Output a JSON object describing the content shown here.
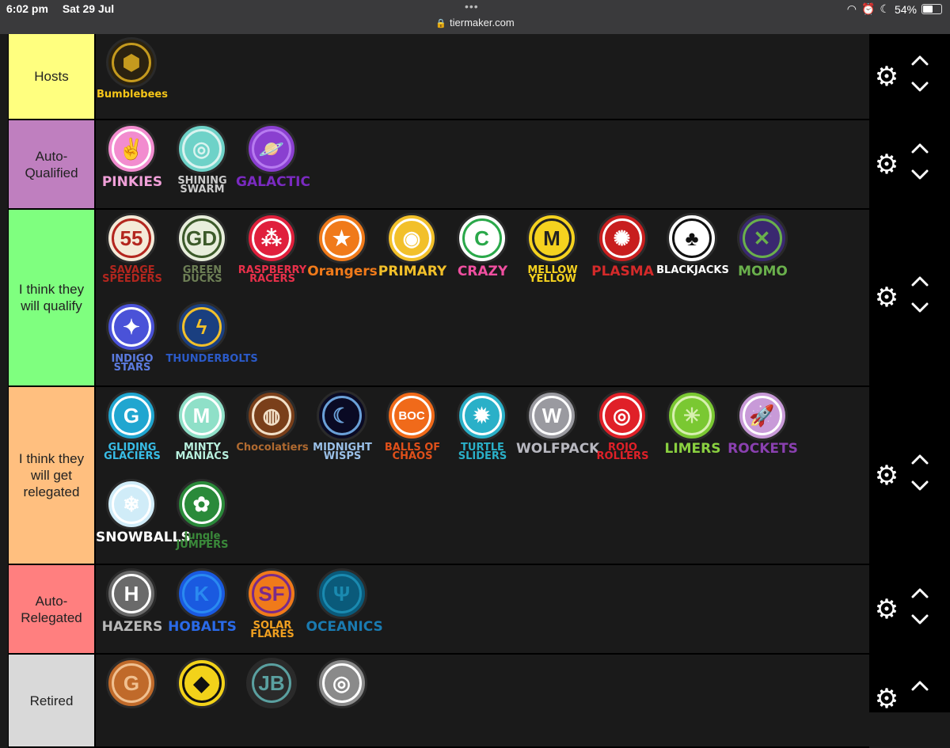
{
  "status": {
    "time": "6:02 pm",
    "date": "Sat 29 Jul",
    "battery": "54%",
    "dots": "•••"
  },
  "browser": {
    "url": "tiermaker.com"
  },
  "tiers": [
    {
      "label": "Hosts",
      "color": "#ffff7f",
      "teams": [
        {
          "name": "Bumblebees",
          "bg": "#2b2210",
          "ring": "#c59a1e",
          "fg": "#f5c518",
          "glyph": "⬢"
        }
      ]
    },
    {
      "label": "Auto-\nQualified",
      "color": "#bf7fbf",
      "teams": [
        {
          "name": "PINKIES",
          "bg": "#f28ccf",
          "ring": "#ffffff",
          "fg": "#f0a0d8",
          "glyph": "✌"
        },
        {
          "name": "SHINING SWARM",
          "bg": "#6ed2c8",
          "ring": "#d9f3ef",
          "fg": "#cccccc",
          "glyph": "◎"
        },
        {
          "name": "GALACTIC",
          "bg": "#8a3fd0",
          "ring": "#b77bf0",
          "fg": "#7a2ac0",
          "glyph": "🪐"
        }
      ]
    },
    {
      "label": "I think they\nwill qualify",
      "color": "#7fff7f",
      "teams": [
        {
          "name": "SAVAGE SPEEDERS",
          "bg": "#f4ead8",
          "ring": "#b3261e",
          "fg": "#b3261e",
          "glyph": "55"
        },
        {
          "name": "GREEN DUCKS",
          "bg": "#e8eedc",
          "ring": "#3c5a2a",
          "fg": "#6d7f55",
          "glyph": "GD"
        },
        {
          "name": "RASPBERRY RACERS",
          "bg": "#e0203c",
          "ring": "#ffffff",
          "fg": "#e8304a",
          "glyph": "⁂"
        },
        {
          "name": "Orangers",
          "bg": "#f07a1a",
          "ring": "#ffffff",
          "fg": "#f07a1a",
          "glyph": "★"
        },
        {
          "name": "PRIMARY",
          "bg": "#f2c02a",
          "ring": "#ffffff",
          "fg": "#f2c02a",
          "glyph": "◉"
        },
        {
          "name": "CRAZY",
          "bg": "#ffffff",
          "ring": "#2aa84a",
          "fg": "#f04fa0",
          "glyph": "C"
        },
        {
          "name": "MELLOW YELLOW",
          "bg": "#f5d21f",
          "ring": "#222222",
          "fg": "#f5d21f",
          "glyph": "M"
        },
        {
          "name": "PLASMA",
          "bg": "#c81e1e",
          "ring": "#ffffff",
          "fg": "#d42a2a",
          "glyph": "✺"
        },
        {
          "name": "BLACKJACKS",
          "bg": "#ffffff",
          "ring": "#111111",
          "fg": "#ffffff",
          "glyph": "♣"
        },
        {
          "name": "MOMO",
          "bg": "#3a2870",
          "ring": "#6ab04c",
          "fg": "#6ab04c",
          "glyph": "✕"
        },
        {
          "name": "INDIGO STARS",
          "bg": "#4a52d8",
          "ring": "#ffffff",
          "fg": "#5b7be0",
          "glyph": "✦"
        },
        {
          "name": "THUNDERBOLTS",
          "bg": "#1a3f80",
          "ring": "#f2c02a",
          "fg": "#2b5ac8",
          "glyph": "ϟ"
        }
      ]
    },
    {
      "label": "I think they\nwill get\nrelegated",
      "color": "#ffbf7f",
      "teams": [
        {
          "name": "GLIDING GLACIERS",
          "bg": "#20a6d0",
          "ring": "#ffffff",
          "fg": "#38bde6",
          "glyph": "G"
        },
        {
          "name": "MINTY MANIACS",
          "bg": "#8fe0c8",
          "ring": "#ffffff",
          "fg": "#b8f0de",
          "glyph": "M"
        },
        {
          "name": "Chocolatiers",
          "bg": "#7a3f1a",
          "ring": "#f2e0c8",
          "fg": "#b06a30",
          "glyph": "◍"
        },
        {
          "name": "MIDNIGHT WISPS",
          "bg": "#0a0a24",
          "ring": "#6aa0d8",
          "fg": "#9ac0e8",
          "glyph": "☾"
        },
        {
          "name": "BALLS OF CHAOS",
          "bg": "#f06a1a",
          "ring": "#ffffff",
          "fg": "#e0501a",
          "glyph": "BOC"
        },
        {
          "name": "TURTLE SLIDERS",
          "bg": "#2ab0c8",
          "ring": "#ffffff",
          "fg": "#2ab0c8",
          "glyph": "✹"
        },
        {
          "name": "WOLFPACK",
          "bg": "#9a9aa0",
          "ring": "#ffffff",
          "fg": "#b8b8c0",
          "glyph": "W"
        },
        {
          "name": "ROJO ROLLERS",
          "bg": "#e02028",
          "ring": "#ffffff",
          "fg": "#e02028",
          "glyph": "◎"
        },
        {
          "name": "LIMERS",
          "bg": "#7ac832",
          "ring": "#d8f0b0",
          "fg": "#8ad040",
          "glyph": "✳"
        },
        {
          "name": "ROCKETS",
          "bg": "#c89ad8",
          "ring": "#ffffff",
          "fg": "#8a40b0",
          "glyph": "🚀"
        },
        {
          "name": "SNOWBALLS",
          "bg": "#d0ecf8",
          "ring": "#ffffff",
          "fg": "#ffffff",
          "glyph": "❄"
        },
        {
          "name": "Jungle JUMPERS",
          "bg": "#2a8a3a",
          "ring": "#ffffff",
          "fg": "#3a8a3a",
          "glyph": "✿"
        }
      ]
    },
    {
      "label": "Auto-\nRelegated",
      "color": "#ff7f7f",
      "teams": [
        {
          "name": "HAZERS",
          "bg": "#6a6a6a",
          "ring": "#ffffff",
          "fg": "#b8b8b8",
          "glyph": "H"
        },
        {
          "name": "HOBALTS",
          "bg": "#1a5ae0",
          "ring": "#2a8af0",
          "fg": "#2a6ae8",
          "glyph": "K"
        },
        {
          "name": "SOLAR FLARES",
          "bg": "#f07a1a",
          "ring": "#7a2a8a",
          "fg": "#f0a020",
          "glyph": "SF"
        },
        {
          "name": "OCEANICS",
          "bg": "#0a5a7a",
          "ring": "#1a8ab0",
          "fg": "#1a7ab0",
          "glyph": "Ψ"
        }
      ]
    },
    {
      "label": "Retired",
      "color": "#d9d9d9",
      "teams": [
        {
          "name": "",
          "bg": "#c06a2a",
          "ring": "#f0c090",
          "fg": "#c06a2a",
          "glyph": "G"
        },
        {
          "name": "",
          "bg": "#f2d21a",
          "ring": "#111111",
          "fg": "#f2d21a",
          "glyph": "◆"
        },
        {
          "name": "",
          "bg": "#2a2a2a",
          "ring": "#5aa0a0",
          "fg": "#aaaaaa",
          "glyph": "JB"
        },
        {
          "name": "",
          "bg": "#8a8a8a",
          "ring": "#ffffff",
          "fg": "#aaaaaa",
          "glyph": "◎"
        }
      ]
    }
  ]
}
